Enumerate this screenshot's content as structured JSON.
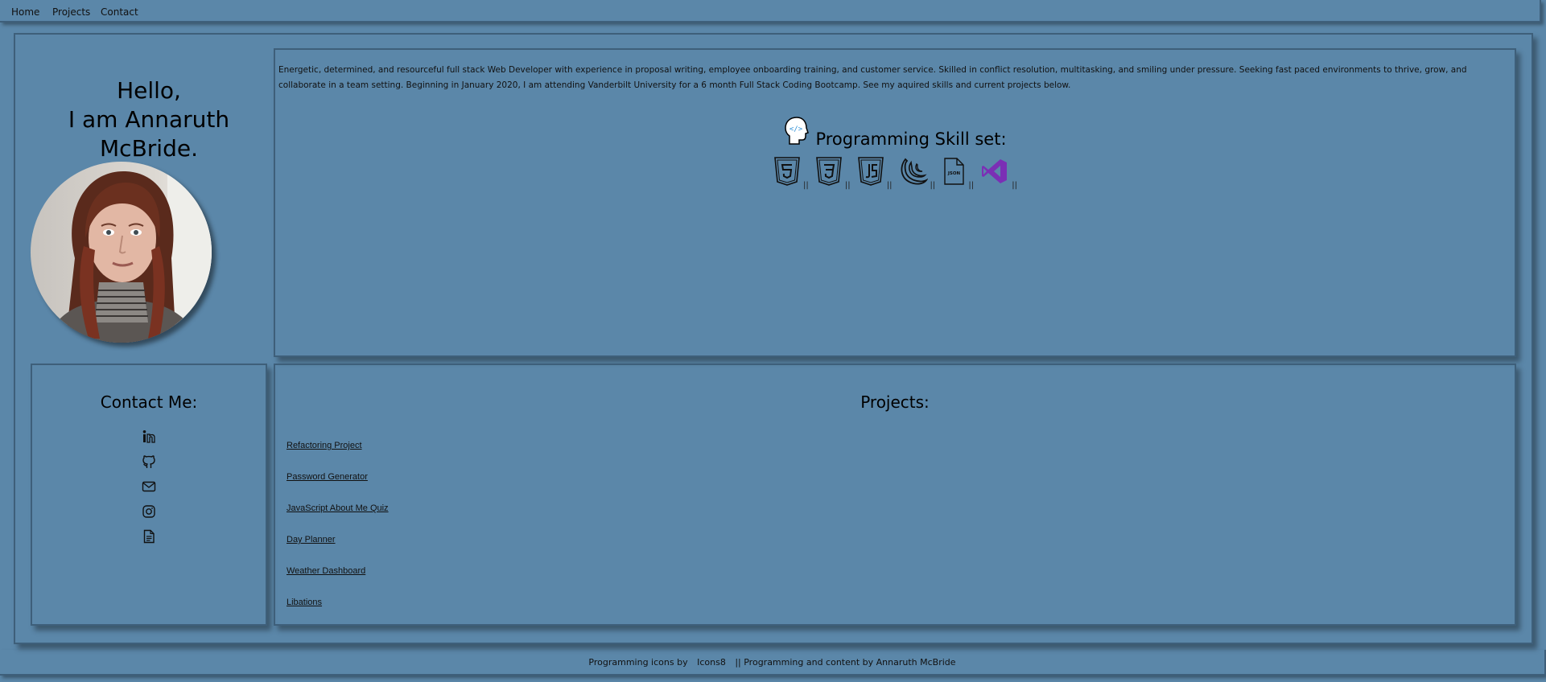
{
  "nav": {
    "items": [
      {
        "label": "Home"
      },
      {
        "label": "Projects"
      },
      {
        "label": "Contact"
      }
    ]
  },
  "hero": {
    "line1": "Hello,",
    "line2": "I am Annaruth McBride."
  },
  "about": {
    "text": "Energetic, determined, and resourceful full stack Web Developer with experience in proposal writing, employee onboarding training, and customer service. Skilled in conflict resolution, multitasking, and smiling under pressure. Seeking fast paced environments to thrive, grow, and collaborate in a team setting. Beginning in January 2020, I am attending Vanderbilt University for a 6 month Full Stack Coding Bootcamp. See my aquired skills and current projects below.",
    "skills_title": "Programming Skill set:",
    "separator": "||",
    "skills": [
      "html5-icon",
      "css3-icon",
      "javascript-icon",
      "jquery-icon",
      "json-icon",
      "visual-studio-icon"
    ],
    "json_icon_text": "JSON"
  },
  "contact": {
    "title": "Contact Me:",
    "icons": [
      "linkedin-icon",
      "github-icon",
      "email-icon",
      "instagram-icon",
      "resume-icon"
    ]
  },
  "projects": {
    "title": "Projects:",
    "items": [
      {
        "label": "Refactoring Project"
      },
      {
        "label": "Password Generator"
      },
      {
        "label": "JavaScript About Me Quiz"
      },
      {
        "label": "Day Planner"
      },
      {
        "label": "Weather Dashboard"
      },
      {
        "label": "Libations"
      }
    ]
  },
  "footer": {
    "prefix": "Programming icons by",
    "link": "Icons8",
    "suffix": "|| Programming and content by Annaruth McBride"
  },
  "colors": {
    "background": "#5b87a9",
    "border": "#3e5f7a",
    "visual_studio": "#7b2fb5"
  }
}
